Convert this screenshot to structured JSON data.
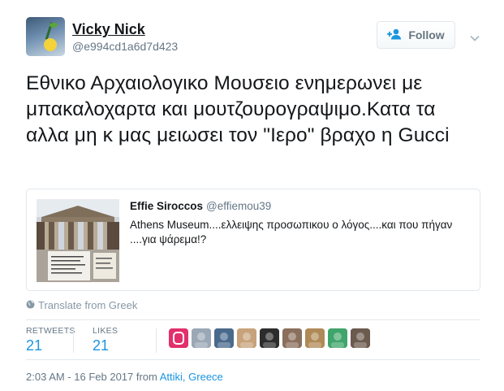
{
  "author": {
    "name": "Vicky Nick",
    "handle": "@e994cd1a6d7d423",
    "follow_label": "Follow"
  },
  "tweet": {
    "text": "Εθνικο Αρχαιολογικο Μουσειο ενημερωνει με μπακαλοχαρτα και μουτζουρογραψιμο.Κατα τα αλλα μη κ μας μειωσει τον \"Ιερο\" βραχο η Gucci"
  },
  "quoted": {
    "name": "Effie Siroccos",
    "handle": "@effiemou39",
    "text": "Athens Museum....ελλειψης προσωπικου ο λόγος....και που πήγαν ....για ψάρεμα!?"
  },
  "translate_label": "Translate from Greek",
  "stats": {
    "retweets_label": "RETWEETS",
    "retweets_value": "21",
    "likes_label": "LIKES",
    "likes_value": "21"
  },
  "likers": [
    {
      "icon": "instagram-style-avatar",
      "color": "#e1306c"
    },
    {
      "icon": "user-avatar",
      "color": "#9aa7b5"
    },
    {
      "icon": "user-avatar",
      "color": "#4a6a8c"
    },
    {
      "icon": "user-avatar",
      "color": "#c7a27a"
    },
    {
      "icon": "user-avatar",
      "color": "#2d2d2d"
    },
    {
      "icon": "user-avatar",
      "color": "#8a6f5c"
    },
    {
      "icon": "user-avatar",
      "color": "#b08a56"
    },
    {
      "icon": "user-avatar",
      "color": "#3fa56b"
    },
    {
      "icon": "user-avatar",
      "color": "#6b5a4e"
    }
  ],
  "footer": {
    "timestamp": "2:03 AM - 16 Feb 2017 from ",
    "location": "Attiki, Greece"
  },
  "colors": {
    "link_blue": "#1b95e0",
    "secondary_gray": "#657786",
    "border": "#e1e8ed"
  }
}
